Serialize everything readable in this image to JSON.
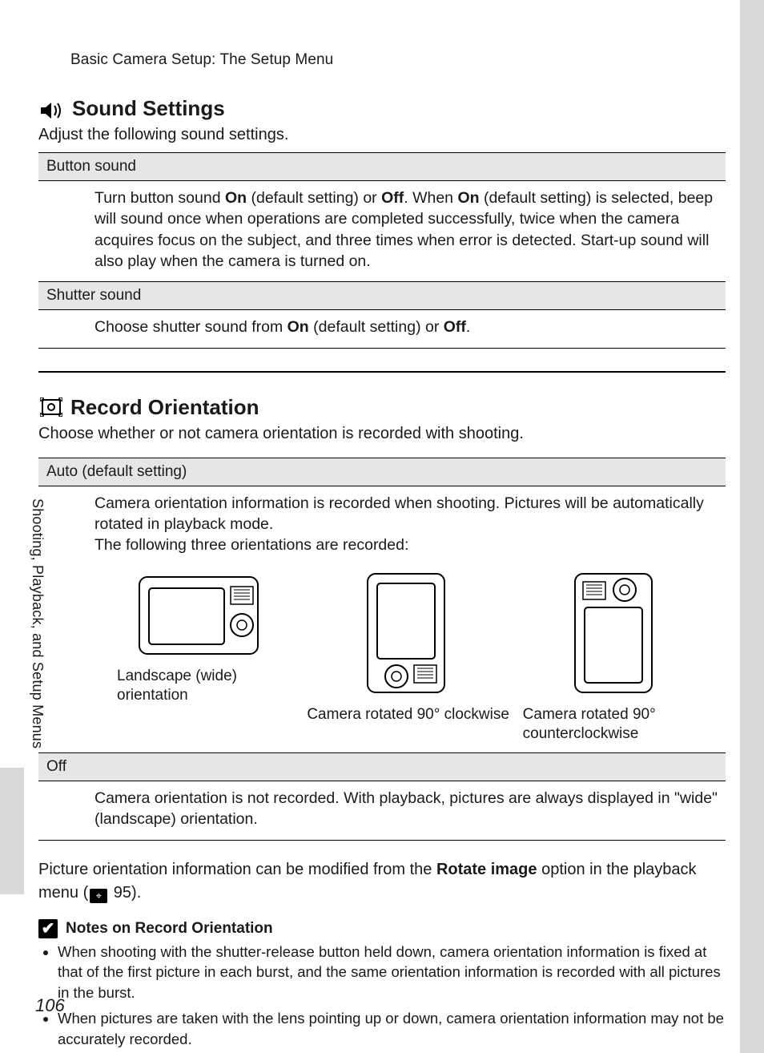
{
  "breadcrumb": "Basic Camera Setup: The Setup Menu",
  "sound": {
    "title": "Sound Settings",
    "intro": "Adjust the following sound settings.",
    "button_sound_label": "Button sound",
    "button_sound_body": "Turn button sound <strong>On</strong> (default setting) or <strong>Off</strong>. When <strong>On</strong> (default setting) is selected, beep will sound once when operations are completed successfully, twice when the camera acquires focus on the subject, and three times when error is detected. Start-up sound will also play when the camera is turned on.",
    "shutter_sound_label": "Shutter sound",
    "shutter_sound_body": "Choose shutter sound from <strong>On</strong> (default setting) or <strong>Off</strong>."
  },
  "record": {
    "title": "Record Orientation",
    "intro": "Choose whether or not camera orientation is recorded with shooting.",
    "auto_label": "Auto (default setting)",
    "auto_body_p1": "Camera orientation information is recorded when shooting. Pictures will be automatically rotated in playback mode.",
    "auto_body_p2": "The following three orientations are recorded:",
    "orientations": [
      {
        "label": "Landscape (wide) orientation"
      },
      {
        "label": "Camera rotated 90° clockwise"
      },
      {
        "label": "Camera rotated 90° counterclockwise"
      }
    ],
    "off_label": "Off",
    "off_body": "Camera orientation is not recorded. With playback, pictures are always displayed in \"wide\" (landscape) orientation.",
    "below": "Picture orientation information can be modified from the <strong>Rotate image</strong> option in the playback menu (<span class='manual-icon'>⌖</span> 95)."
  },
  "notes": {
    "title": "Notes on Record Orientation",
    "items": [
      "When shooting with the shutter-release button held down, camera orientation information is fixed at that of the first picture in each burst, and the same orientation information is recorded with all pictures in the burst.",
      "When pictures are taken with the lens pointing up or down, camera orientation information may not be accurately recorded."
    ]
  },
  "sidebar_label": "Shooting, Playback, and Setup Menus",
  "page_number": "106"
}
